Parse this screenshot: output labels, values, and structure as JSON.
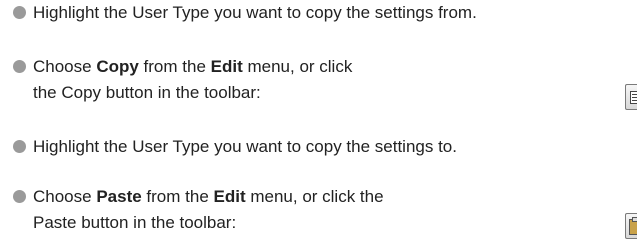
{
  "steps": [
    {
      "text": "Highlight the User Type you want to copy the settings from."
    },
    {
      "pre": "Choose ",
      "bold1": "Copy",
      "mid": " from the ",
      "bold2": "Edit",
      "post": " menu, or click",
      "line2": "the Copy button in the toolbar:",
      "icon": "copy-icon"
    },
    {
      "text": "Highlight the User Type you want to copy the settings to."
    },
    {
      "pre": "Choose ",
      "bold1": "Paste",
      "mid": " from the ",
      "bold2": "Edit",
      "post": " menu, or click the",
      "line2": "Paste button in the toolbar:",
      "icon": "paste-icon"
    }
  ]
}
